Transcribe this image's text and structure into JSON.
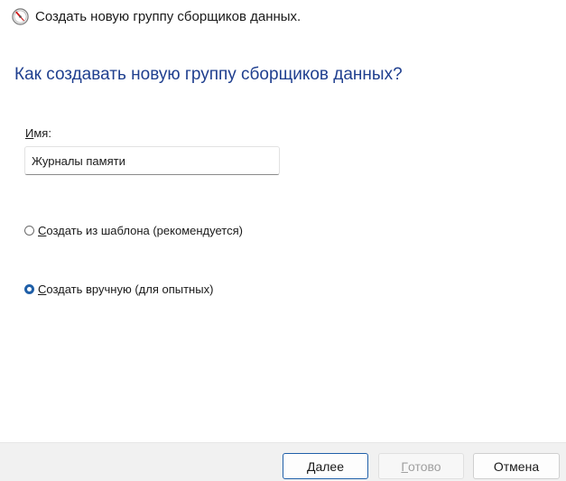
{
  "window": {
    "title": "Создать новую группу сборщиков данных.",
    "title_icon": "performance-monitor-icon"
  },
  "heading": "Как создавать новую группу сборщиков данных?",
  "name_field": {
    "label_accel": "И",
    "label_rest": "мя:",
    "value": "Журналы памяти"
  },
  "options": [
    {
      "accel": "С",
      "rest": "оздать из шаблона (рекомендуется)",
      "checked": false
    },
    {
      "accel": "С",
      "rest": "оздать вручную (для опытных)",
      "checked": true
    }
  ],
  "buttons": {
    "next": {
      "accel": "Д",
      "rest": "алее"
    },
    "finish": {
      "accel": "Г",
      "rest": "отово",
      "disabled": true
    },
    "cancel": "Отмена"
  },
  "colors": {
    "heading": "#1f3f8f",
    "accent": "#1f5fa8"
  }
}
